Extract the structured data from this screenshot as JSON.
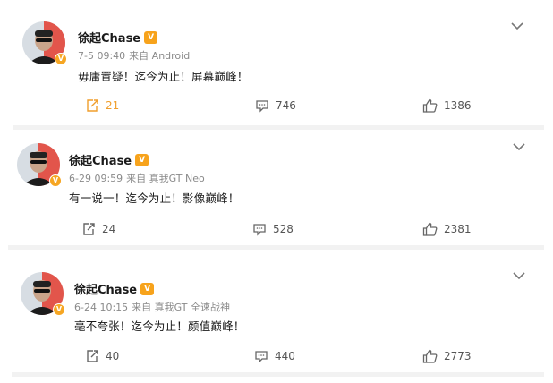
{
  "posts": [
    {
      "author": "徐起Chase",
      "badge_icon": "vip-crown-icon",
      "date": "7-5 09:40",
      "source": "来自 Android",
      "text": "毋庸置疑！迄今为止！屏幕巅峰！",
      "reposts": "21",
      "comments": "746",
      "likes": "1386",
      "repost_active": true
    },
    {
      "author": "徐起Chase",
      "badge_icon": "vip-crown-icon",
      "date": "6-29 09:59",
      "source": "来自 真我GT Neo",
      "text": "有一说一！迄今为止！影像巅峰！",
      "reposts": "24",
      "comments": "528",
      "likes": "2381",
      "repost_active": false
    },
    {
      "author": "徐起Chase",
      "badge_icon": "vip-crown-icon",
      "date": "6-24 10:15",
      "source": "来自 真我GT 全速战神",
      "text": "毫不夸张！迄今为止！颜值巅峰！",
      "reposts": "40",
      "comments": "440",
      "likes": "2773",
      "repost_active": false
    }
  ],
  "colors": {
    "accent_orange": "#f09e2c",
    "meta_gray": "#8a8a8a",
    "divider": "#f2f2f2"
  }
}
